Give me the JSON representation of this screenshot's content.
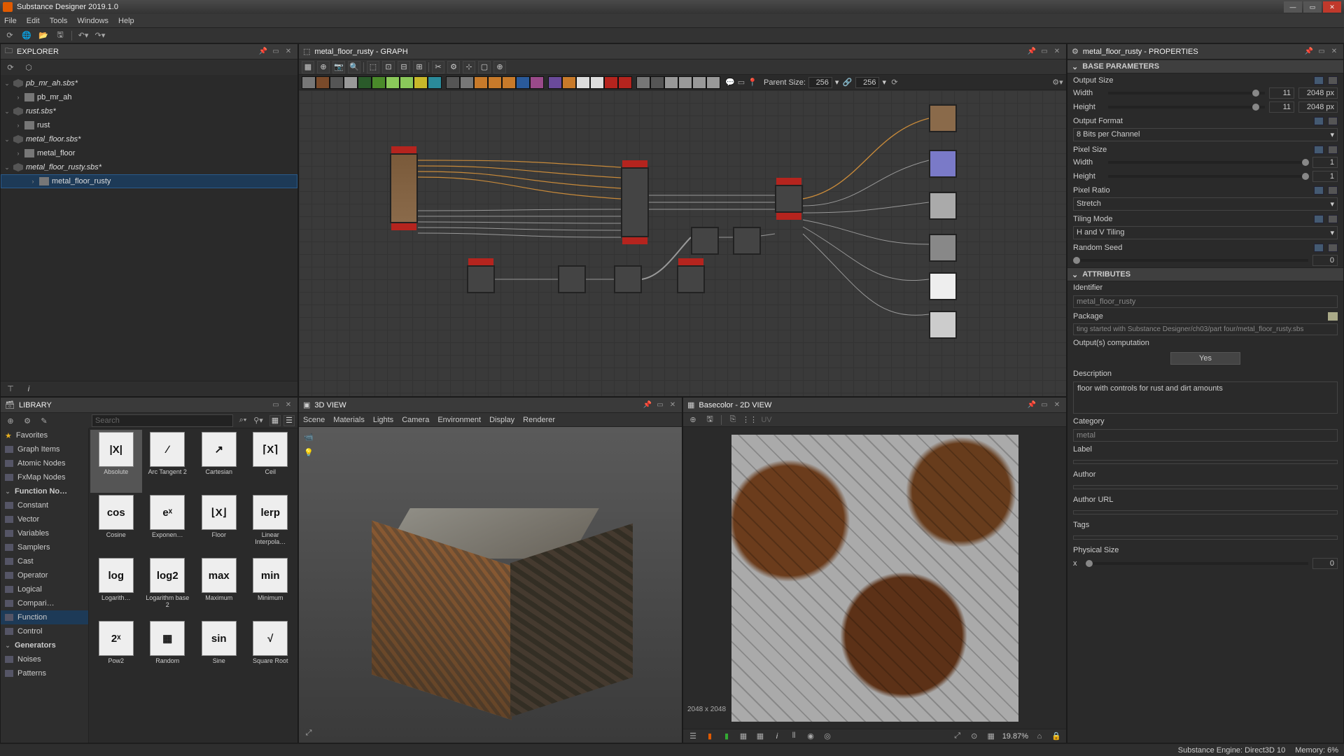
{
  "app": {
    "title": "Substance Designer 2019.1.0"
  },
  "menu": [
    "File",
    "Edit",
    "Tools",
    "Windows",
    "Help"
  ],
  "toolbaricons": [
    "refresh",
    "globe",
    "folder-open",
    "save-all",
    "undo",
    "redo"
  ],
  "explorer": {
    "title": "EXPLORER",
    "tree": [
      {
        "kind": "pkg",
        "label": "pb_mr_ah.sbs*",
        "indent": 0,
        "expanded": true
      },
      {
        "kind": "graph",
        "label": "pb_mr_ah",
        "indent": 1
      },
      {
        "kind": "pkg",
        "label": "rust.sbs*",
        "indent": 0,
        "expanded": true
      },
      {
        "kind": "graph",
        "label": "rust",
        "indent": 1
      },
      {
        "kind": "pkg",
        "label": "metal_floor.sbs*",
        "indent": 0,
        "expanded": true
      },
      {
        "kind": "graph",
        "label": "metal_floor",
        "indent": 1
      },
      {
        "kind": "pkg",
        "label": "metal_floor_rusty.sbs*",
        "indent": 0,
        "expanded": true
      },
      {
        "kind": "graph",
        "label": "metal_floor_rusty",
        "indent": 1,
        "selected": true
      }
    ]
  },
  "graph": {
    "title": "metal_floor_rusty - GRAPH",
    "parent_label": "Parent Size:",
    "parent_w": "256",
    "parent_h": "256"
  },
  "properties": {
    "title": "metal_floor_rusty - PROPERTIES",
    "base_header": "BASE PARAMETERS",
    "attr_header": "ATTRIBUTES",
    "output_size_label": "Output Size",
    "width_label": "Width",
    "height_label": "Height",
    "output_size_w_exp": "11",
    "output_size_w_px": "2048 px",
    "output_size_h_exp": "11",
    "output_size_h_px": "2048 px",
    "output_format_label": "Output Format",
    "output_format_value": "8 Bits per Channel",
    "pixel_size_label": "Pixel Size",
    "pixel_size_w": "1",
    "pixel_size_h": "1",
    "pixel_ratio_label": "Pixel Ratio",
    "pixel_ratio_value": "Stretch",
    "tiling_label": "Tiling Mode",
    "tiling_value": "H and V Tiling",
    "random_seed_label": "Random Seed",
    "random_seed_value": "0",
    "identifier_label": "Identifier",
    "identifier_value": "metal_floor_rusty",
    "package_label": "Package",
    "package_value": "ting started with Substance Designer/ch03/part four/metal_floor_rusty.sbs",
    "outputs_comp_label": "Output(s) computation",
    "outputs_comp_value": "Yes",
    "description_label": "Description",
    "description_value": "floor with controls for rust and dirt amounts",
    "category_label": "Category",
    "category_value": "metal",
    "label_label": "Label",
    "author_label": "Author",
    "authorurl_label": "Author URL",
    "tags_label": "Tags",
    "physsize_label": "Physical Size",
    "physsize_x_label": "x",
    "physsize_x": "0"
  },
  "library": {
    "title": "LIBRARY",
    "search_placeholder": "Search",
    "favorites": "Favorites",
    "side": [
      "Graph Items",
      "Atomic Nodes",
      "FxMap Nodes"
    ],
    "funcheader": "Function No…",
    "funcs": [
      "Constant",
      "Vector",
      "Variables",
      "Samplers",
      "Cast",
      "Operator",
      "Logical",
      "Compari…",
      "Function",
      "Control"
    ],
    "gens_header": "Generators",
    "gens": [
      "Noises",
      "Patterns"
    ],
    "items": [
      {
        "name": "Absolute",
        "thumb": "|X|",
        "sel": true
      },
      {
        "name": "Arc Tangent 2",
        "thumb": "∕"
      },
      {
        "name": "Cartesian",
        "thumb": "↗"
      },
      {
        "name": "Ceil",
        "thumb": "⌈X⌉"
      },
      {
        "name": "Cosine",
        "thumb": "cos"
      },
      {
        "name": "Exponen…",
        "thumb": "eˣ"
      },
      {
        "name": "Floor",
        "thumb": "⌊X⌋"
      },
      {
        "name": "Linear Interpola…",
        "thumb": "lerp"
      },
      {
        "name": "Logarith…",
        "thumb": "log"
      },
      {
        "name": "Logarithm base 2",
        "thumb": "log2"
      },
      {
        "name": "Maximum",
        "thumb": "max"
      },
      {
        "name": "Minimum",
        "thumb": "min"
      },
      {
        "name": "Pow2",
        "thumb": "2ˣ"
      },
      {
        "name": "Random",
        "thumb": "▦"
      },
      {
        "name": "Sine",
        "thumb": "sin"
      },
      {
        "name": "Square Root",
        "thumb": "√"
      }
    ]
  },
  "view3d": {
    "title": "3D VIEW",
    "menu": [
      "Scene",
      "Materials",
      "Lights",
      "Camera",
      "Environment",
      "Display",
      "Renderer"
    ]
  },
  "view2d": {
    "title": "Basecolor - 2D VIEW",
    "dim": "2048 x 2048",
    "zoom": "19.87%"
  },
  "status": {
    "engine": "Substance Engine: Direct3D 10",
    "memory": "Memory: 6%"
  }
}
